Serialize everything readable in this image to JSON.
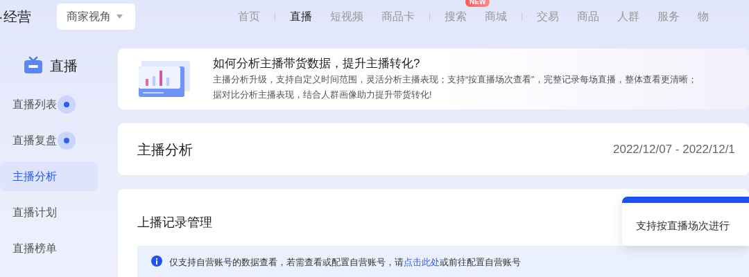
{
  "header": {
    "brand": "·经营",
    "view_select": "商家视角"
  },
  "nav": [
    [
      {
        "label": "首页",
        "selected": false
      }
    ],
    [
      {
        "label": "直播",
        "selected": true
      },
      {
        "label": "短视频",
        "selected": false
      },
      {
        "label": "商品卡",
        "selected": false
      }
    ],
    [
      {
        "label": "搜索",
        "selected": false,
        "badge": "NEW"
      },
      {
        "label": "商城",
        "selected": false
      }
    ],
    [
      {
        "label": "交易",
        "selected": false
      },
      {
        "label": "商品",
        "selected": false
      },
      {
        "label": "人群",
        "selected": false
      },
      {
        "label": "服务",
        "selected": false
      },
      {
        "label": "物",
        "selected": false
      }
    ]
  ],
  "sidebar": {
    "title": "直播",
    "items": [
      {
        "label": "直播列表",
        "selected": false,
        "dot": true
      },
      {
        "label": "直播复盘",
        "selected": false,
        "dot": true
      },
      {
        "label": "主播分析",
        "selected": true,
        "dot": false
      },
      {
        "label": "直播计划",
        "selected": false,
        "dot": false
      },
      {
        "label": "直播榜单",
        "selected": false,
        "dot": false
      }
    ]
  },
  "banner": {
    "title": "如何分析主播带货数据，提升主播转化?",
    "lines": [
      "主播分析升级，支持自定义时间范围，灵活分析主播表现；支持“按直播场次查看”，完整记录每场直播，整体查看更清晰；",
      "据对比分析主播表现，结合人群画像助力提升带货转化!"
    ]
  },
  "page": {
    "title": "主播分析",
    "date_range": "2022/12/07 - 2022/12/1"
  },
  "records": {
    "title": "上播记录管理",
    "notice": {
      "before": "仅支持自营账号的数据查看，若需查看或配置自营账号，请",
      "link": "点击此处",
      "after": "或前往配置自营账号"
    }
  },
  "tooltip": {
    "text": "支持按直播场次进行"
  }
}
